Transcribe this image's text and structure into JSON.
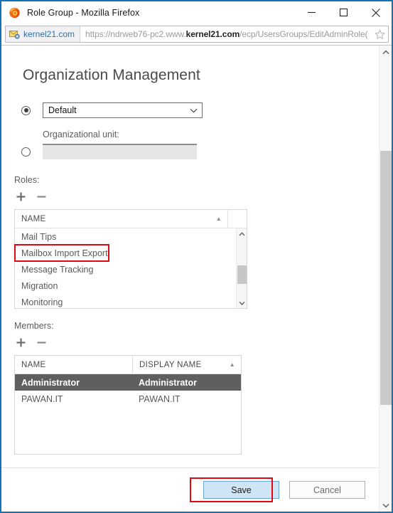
{
  "window": {
    "title": "Role Group - Mozilla Firefox",
    "app_icon": "firefox-icon",
    "border_color": "#1273b8",
    "controls": {
      "minimize": "–",
      "maximize": "☐",
      "close": "✕"
    }
  },
  "navbar": {
    "identity_label": "kernel21.com",
    "identity_icon": "mail-settings-icon",
    "url_prefix": "https://ndrweb76-pc2.www.",
    "url_domain": "kernel21.com",
    "url_suffix": "/ecp/UsersGroups/EditAdminRole(",
    "bookmark_icon": "star-icon"
  },
  "main": {
    "heading": "Organization Management",
    "scope": {
      "default_option": {
        "selected": true,
        "value": "Default",
        "dropdown_icon": "chevron-down-icon"
      },
      "ou_option": {
        "selected": false,
        "label": "Organizational unit:",
        "value": "",
        "placeholder": ""
      }
    },
    "roles": {
      "label": "Roles:",
      "add_icon": "plus-icon",
      "remove_icon": "minus-icon",
      "columns": [
        "NAME"
      ],
      "sort_icon": "sort-ascending-icon",
      "rows": [
        {
          "name": "Mail Tips",
          "highlighted": false
        },
        {
          "name": "Mailbox Import Export",
          "highlighted": true
        },
        {
          "name": "Message Tracking",
          "highlighted": false
        },
        {
          "name": "Migration",
          "highlighted": false
        },
        {
          "name": "Monitoring",
          "highlighted": false
        }
      ],
      "scroll_up_icon": "chevron-up-icon",
      "scroll_down_icon": "chevron-down-icon"
    },
    "members": {
      "label": "Members:",
      "add_icon": "plus-icon",
      "remove_icon": "minus-icon",
      "columns": [
        "NAME",
        "DISPLAY NAME"
      ],
      "sort_icon": "sort-ascending-icon",
      "rows": [
        {
          "name": "Administrator",
          "display_name": "Administrator",
          "selected": true
        },
        {
          "name": "PAWAN.IT",
          "display_name": "PAWAN.IT",
          "selected": false
        }
      ]
    }
  },
  "footer": {
    "save_label": "Save",
    "cancel_label": "Cancel",
    "save_highlighted": true
  },
  "highlight_color": "#e30613",
  "selection_color": "#5f5f5f",
  "page_scrollbar": {
    "up_icon": "chevron-up-icon",
    "down_icon": "chevron-down-icon"
  }
}
